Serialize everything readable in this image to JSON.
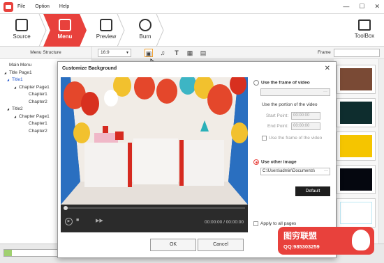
{
  "menubar": {
    "items": [
      "File",
      "Option",
      "Help"
    ],
    "window_buttons": [
      "—",
      "☐",
      "✕"
    ]
  },
  "steps": [
    {
      "label": "Source",
      "icon": "source-icon"
    },
    {
      "label": "Menu",
      "icon": "menu-icon"
    },
    {
      "label": "Preview",
      "icon": "preview-icon"
    },
    {
      "label": "Burn",
      "icon": "burn-icon"
    }
  ],
  "toolbox": {
    "label": "ToolBox",
    "icon": "toolbox-icon"
  },
  "toolbar": {
    "menu_structure": "Menu Structure",
    "ratio": "16:9",
    "icons": [
      "image-icon",
      "music-icon",
      "text-icon",
      "chapter-icon",
      "document-icon"
    ],
    "frame_label": "Frame"
  },
  "tree": [
    {
      "label": "Main Menu",
      "level": 0,
      "toggle": ""
    },
    {
      "label": "Title Page1",
      "level": 0,
      "toggle": "◢"
    },
    {
      "label": "Title1",
      "level": 1,
      "toggle": "◢"
    },
    {
      "label": "Chapter Page1",
      "level": 2,
      "toggle": "◢"
    },
    {
      "label": "Chapter1",
      "level": 3,
      "toggle": ""
    },
    {
      "label": "Chapter2",
      "level": 3,
      "toggle": ""
    },
    {
      "label": "Title2",
      "level": 1,
      "toggle": "◢"
    },
    {
      "label": "Chapter Page1",
      "level": 2,
      "toggle": "◢"
    },
    {
      "label": "Chapter1",
      "level": 3,
      "toggle": ""
    },
    {
      "label": "Chapter2",
      "level": 3,
      "toggle": ""
    }
  ],
  "thumbs": [
    "#7a4a35",
    "#0e2d2e",
    "#f5c500",
    "#05070f",
    "#ffffff"
  ],
  "dialog": {
    "title": "Customize Background",
    "close": "✕",
    "time": "00:00:00 / 00:00:00",
    "use_frame_label": "Use the frame of video",
    "portion_label": "Use the portion of the video",
    "start_label": "Start Point:",
    "start_value": "00:00:00",
    "end_label": "End Point:",
    "end_value": "00:00:00",
    "use_frame_check": "Use the frame of the video",
    "other_image_label": "Use other image",
    "image_path": "C:\\Users\\admin\\Documents\\",
    "browse": "···",
    "default_button": "Default",
    "apply_all": "Apply to all pages",
    "ok": "OK",
    "cancel": "Cancel"
  },
  "capacity": {
    "fill_fraction": 0.12
  },
  "watermark": {
    "title": "图穷联盟",
    "sub": "QQ:985303259"
  }
}
